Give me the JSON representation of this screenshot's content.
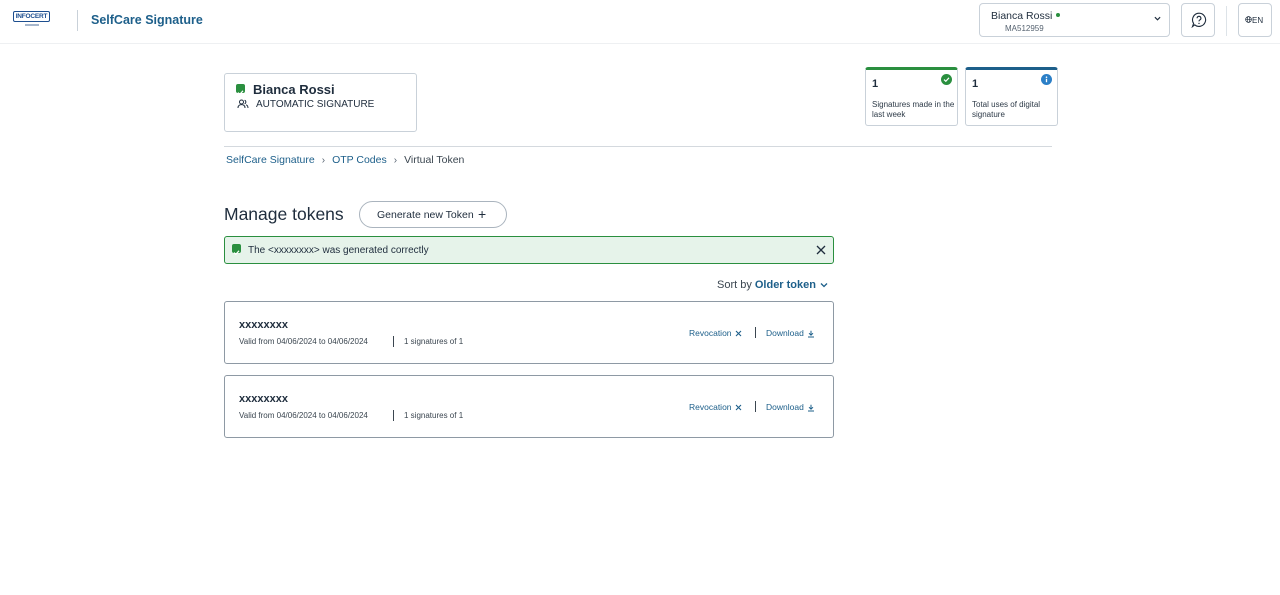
{
  "header": {
    "logo_text": "INFOCERT",
    "app_title": "SelfCare Signature",
    "user": {
      "name": "Bianca Rossi",
      "code": "MA512959"
    },
    "language": "EN"
  },
  "profile": {
    "name": "Bianca Rossi",
    "signature_type": "AUTOMATIC SIGNATURE"
  },
  "stats": [
    {
      "value": "1",
      "label": "Signatures made in the last week",
      "accent": "#2a8f3f"
    },
    {
      "value": "1",
      "label": "Total uses of digital signature",
      "accent": "#1d5f8a"
    }
  ],
  "breadcrumb": {
    "items": [
      "SelfCare Signature",
      "OTP Codes",
      "Virtual Token"
    ],
    "separator": "›"
  },
  "main": {
    "title": "Manage tokens",
    "generate_button": "Generate new Token",
    "generate_icon": "+",
    "alert": {
      "prefix": "The",
      "token": "<xxxxxxxx>",
      "suffix": "was generated correctly"
    },
    "sort": {
      "label": "Sort by",
      "value": "Older token"
    },
    "tokens": [
      {
        "name": "xxxxxxxx",
        "validity": "Valid from 04/06/2024 to 04/06/2024",
        "uses": "1 signatures of 1",
        "revoke_label": "Revocation",
        "download_label": "Download"
      },
      {
        "name": "xxxxxxxx",
        "validity": "Valid from 04/06/2024 to 04/06/2024",
        "uses": "1 signatures of 1",
        "revoke_label": "Revocation",
        "download_label": "Download"
      }
    ]
  },
  "icons": {
    "check": "check-icon",
    "users": "users-icon",
    "info": "info-icon",
    "help": "help-icon",
    "globe": "globe-icon",
    "chevron": "chevron-down-icon",
    "close": "close-icon",
    "download": "download-icon"
  },
  "colors": {
    "brand": "#1d5f8a",
    "success": "#2a8f3f",
    "success_bg": "#e6f3ea",
    "info": "#2b7fc7"
  }
}
